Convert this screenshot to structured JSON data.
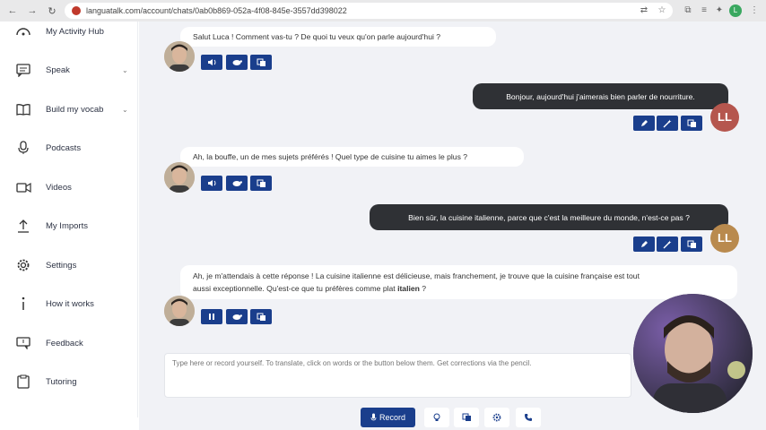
{
  "browser": {
    "url": "languatalk.com/account/chats/0ab0b869-052a-4f08-845e-3557dd398022",
    "profile_initial": "L"
  },
  "sidebar": {
    "items": [
      {
        "label": "My Activity Hub",
        "icon": "target-icon"
      },
      {
        "label": "Speak",
        "icon": "chat-bubble-icon",
        "chevron": "⌄"
      },
      {
        "label": "Build my vocab",
        "icon": "book-icon",
        "chevron": "⌄"
      },
      {
        "label": "Podcasts",
        "icon": "microphone-icon"
      },
      {
        "label": "Videos",
        "icon": "video-camera-icon"
      },
      {
        "label": "My Imports",
        "icon": "upload-icon"
      },
      {
        "label": "Settings",
        "icon": "gear-icon"
      },
      {
        "label": "How it works",
        "icon": "info-icon"
      },
      {
        "label": "Feedback",
        "icon": "feedback-icon"
      },
      {
        "label": "Tutoring",
        "icon": "clipboard-icon"
      }
    ]
  },
  "chat": {
    "messages": [
      {
        "role": "bot",
        "text": "Salut Luca ! Comment vas-tu ? De quoi tu veux qu'on parle aujourd'hui ?"
      },
      {
        "role": "user",
        "text": "Bonjour, aujourd'hui j'aimerais bien parler de nourriture.",
        "initials": "LL"
      },
      {
        "role": "bot",
        "text": "Ah, la bouffe, un de mes sujets préférés ! Quel type de cuisine tu aimes le plus ?"
      },
      {
        "role": "user",
        "text": "Bien sûr, la cuisine italienne, parce que c'est la meilleure du monde, n'est-ce pas ?",
        "initials": "LL"
      },
      {
        "role": "bot",
        "text_line1": "Ah, je m'attendais à cette réponse ! La cuisine italienne est délicieuse, mais franchement, je trouve que la cuisine française est tout",
        "text_line2_pre": "aussi exceptionnelle. Qu'est-ce que tu préfères comme plat ",
        "text_line2_bold": "italien",
        "text_line2_post": " ?"
      }
    ],
    "input_placeholder": "Type here or record yourself. To translate, click on words or the button below them. Get corrections via the pencil.",
    "record_label": "Record"
  },
  "colors": {
    "brand_blue": "#1a3e8c",
    "user_bubble": "#2f3135",
    "user_avatar": "#b5564e",
    "user_avatar_alt": "#b98a4e",
    "chat_bg": "#f1f2f6"
  }
}
